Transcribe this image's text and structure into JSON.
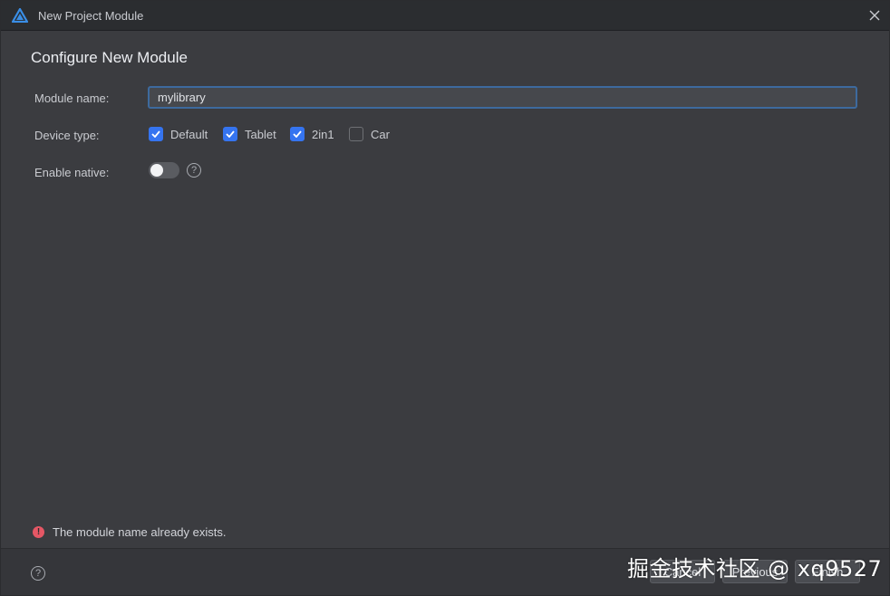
{
  "window": {
    "title": "New Project Module",
    "close_icon": "close-icon",
    "app_icon": "deveco-logo-icon"
  },
  "heading": "Configure New Module",
  "form": {
    "module_name_label": "Module name:",
    "module_name_value": "mylibrary",
    "device_type_label": "Device type:",
    "device_types": [
      {
        "label": "Default",
        "checked": true
      },
      {
        "label": "Tablet",
        "checked": true
      },
      {
        "label": "2in1",
        "checked": true
      },
      {
        "label": "Car",
        "checked": false
      }
    ],
    "enable_native_label": "Enable native:",
    "enable_native_on": false,
    "enable_native_help": "?"
  },
  "error": {
    "icon": "!",
    "message": "The module name already exists."
  },
  "footer": {
    "help": "?",
    "cancel_label": "Cancel",
    "previous_label": "Previous",
    "finish_label": "Finish"
  },
  "watermark": "掘金技术社区 @ xq9527",
  "colors": {
    "accent": "#3574f0",
    "error": "#e55765",
    "background": "#3b3c40"
  }
}
